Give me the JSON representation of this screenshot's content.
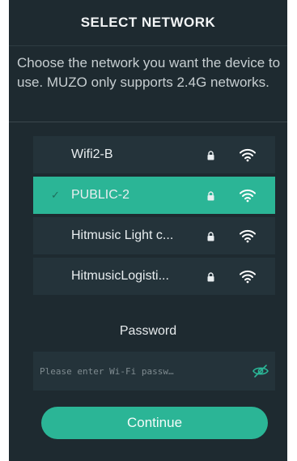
{
  "header": {
    "title": "SELECT NETWORK"
  },
  "description": "Choose the network you want the device to use. MUZO only supports 2.4G networks.",
  "networks": [
    {
      "name": "Wifi2-B",
      "selected": false,
      "secured": true,
      "icon": "wifi-icon"
    },
    {
      "name": "PUBLIC-2",
      "selected": true,
      "secured": true,
      "icon": "wifi-icon",
      "check": "✓"
    },
    {
      "name": "Hitmusic Light c...",
      "selected": false,
      "secured": true,
      "icon": "wifi-icon"
    },
    {
      "name": "HitmusicLogisti...",
      "selected": false,
      "secured": true,
      "icon": "wifi-icon"
    }
  ],
  "password": {
    "label": "Password",
    "placeholder": "Please enter Wi-Fi passw…",
    "value": "",
    "visibility_icon": "eye-slash-icon"
  },
  "continue_label": "Continue",
  "colors": {
    "background": "#1e2a30",
    "item_background": "#24333a",
    "accent": "#2bb596"
  }
}
